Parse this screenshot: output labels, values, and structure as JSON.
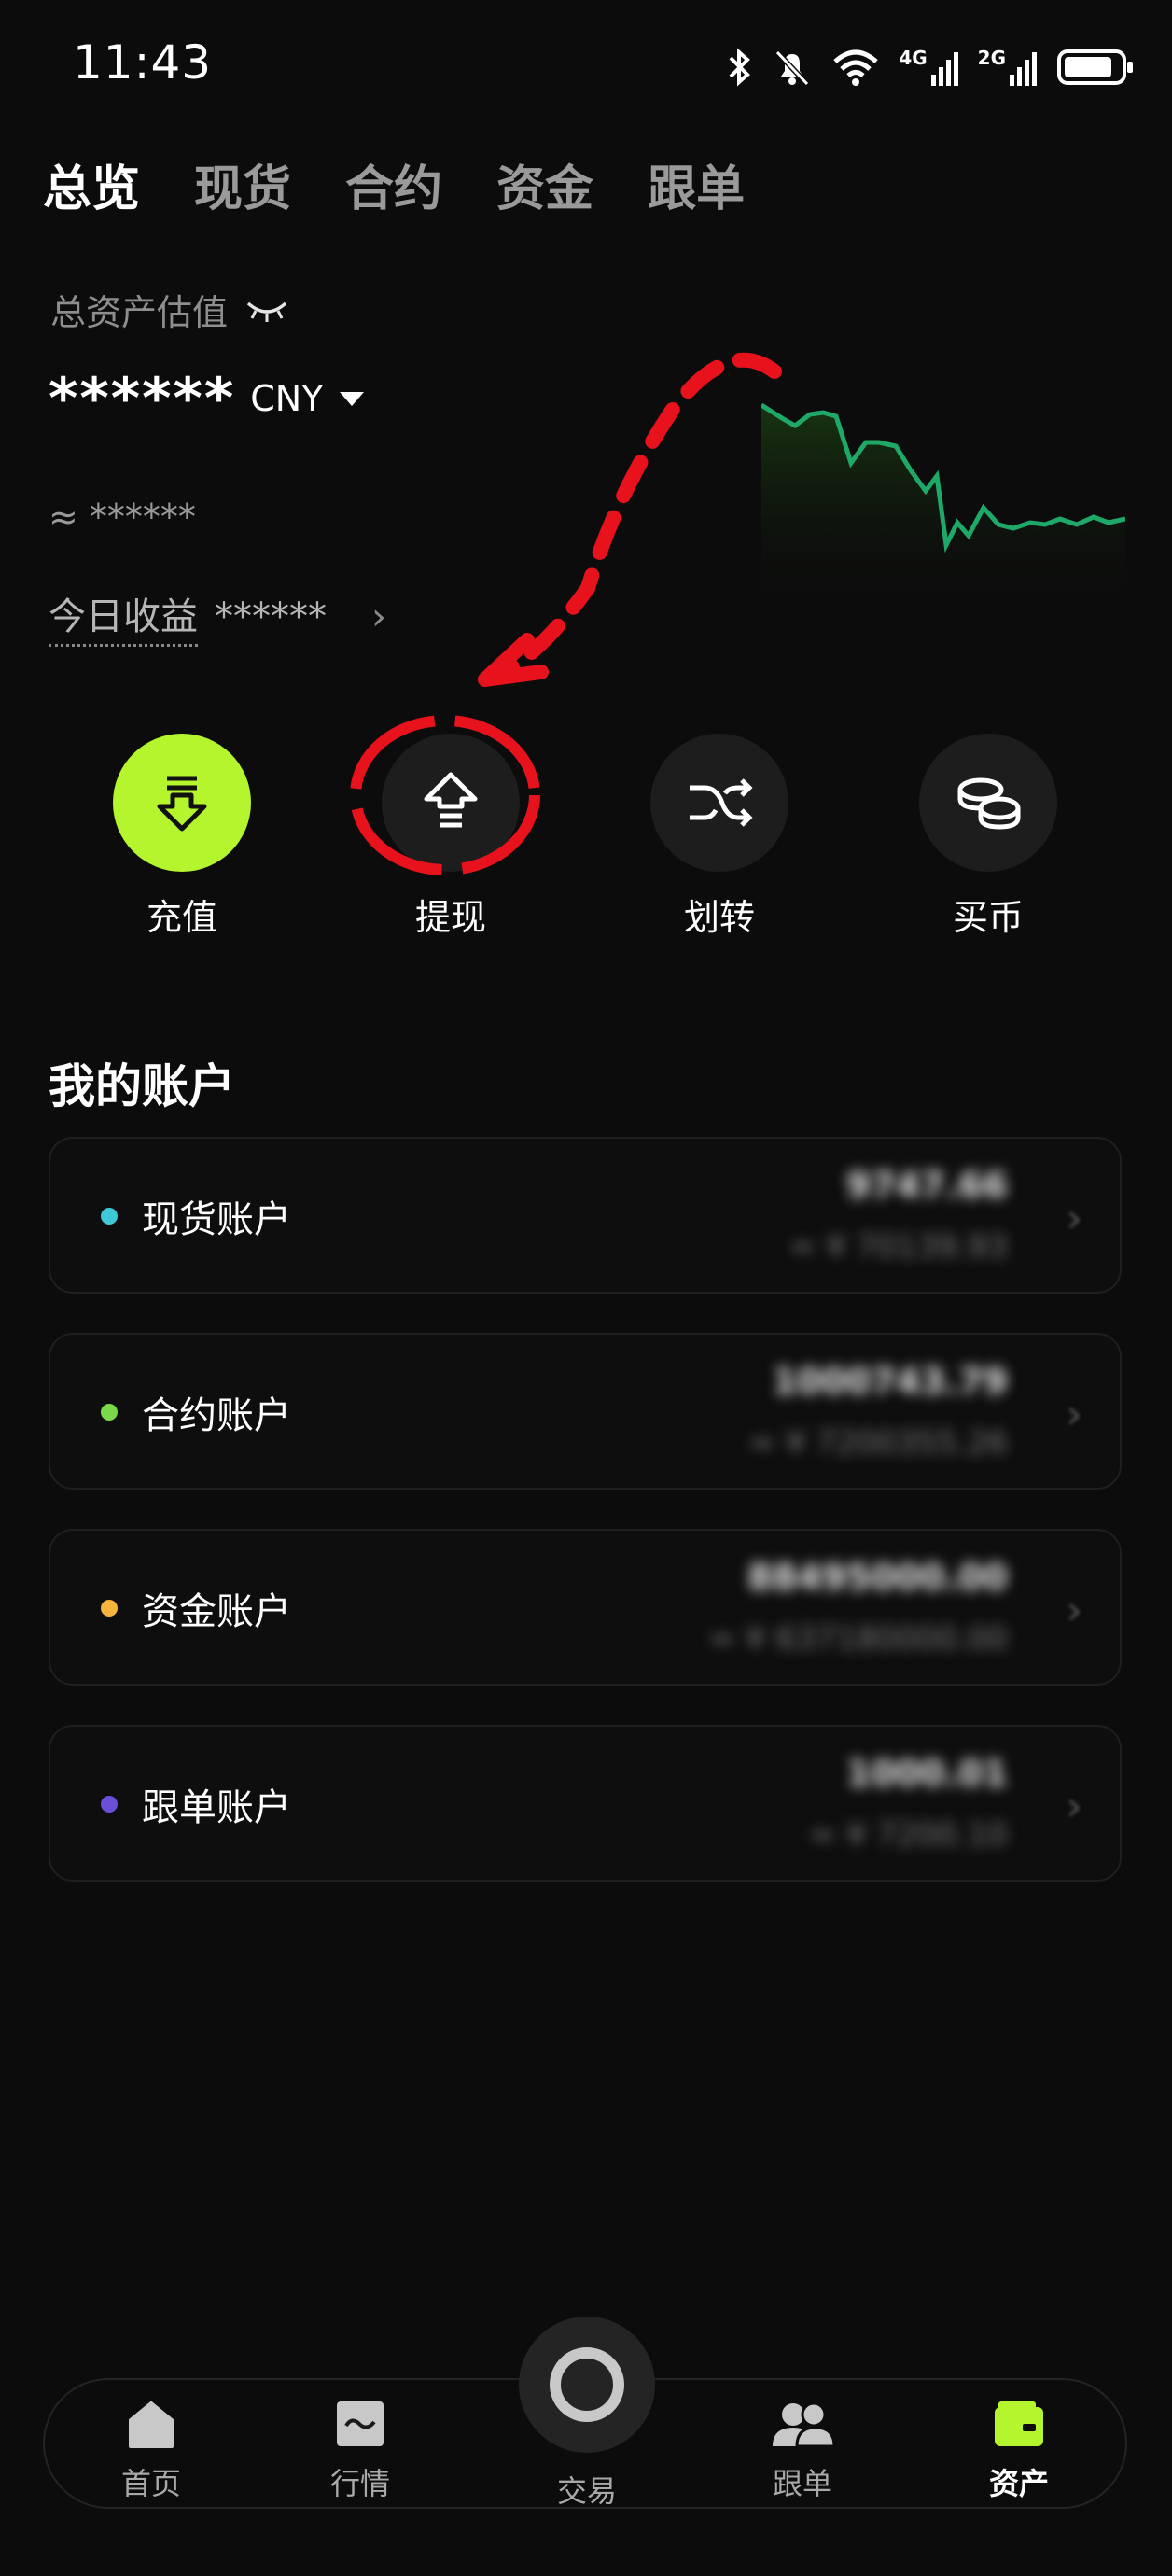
{
  "status_bar": {
    "time": "11:43",
    "signal_4g": "4G",
    "signal_2g": "2G"
  },
  "tabs": [
    {
      "label": "总览",
      "active": true
    },
    {
      "label": "现货",
      "active": false
    },
    {
      "label": "合约",
      "active": false
    },
    {
      "label": "资金",
      "active": false
    },
    {
      "label": "跟单",
      "active": false
    }
  ],
  "overview": {
    "total_label": "总资产估值",
    "total_value": "******",
    "currency": "CNY",
    "approx_value": "≈ ******",
    "pnl_label": "今日收益",
    "pnl_value": "******",
    "sparkline_color": "#1fa968"
  },
  "actions": [
    {
      "label": "充值",
      "icon": "deposit-icon"
    },
    {
      "label": "提现",
      "icon": "withdraw-icon"
    },
    {
      "label": "划转",
      "icon": "transfer-icon"
    },
    {
      "label": "买币",
      "icon": "buy-coin-icon"
    }
  ],
  "accounts": {
    "title": "我的账户",
    "items": [
      {
        "name": "现货账户",
        "dot_color": "#3ec9d6",
        "value": "9747.66",
        "approx": "≈ ¥ 70139.93"
      },
      {
        "name": "合约账户",
        "dot_color": "#7bd84a",
        "value": "1000743.79",
        "approx": "≈ ¥ 7200355.26"
      },
      {
        "name": "资金账户",
        "dot_color": "#f5b53d",
        "value": "88495000.00",
        "approx": "≈ ¥ 637180000.00"
      },
      {
        "name": "跟单账户",
        "dot_color": "#6b4fd8",
        "value": "1000.01",
        "approx": "≈ ¥ 7200.10"
      }
    ]
  },
  "bottom_nav": [
    {
      "label": "首页",
      "icon": "home-icon",
      "active": false
    },
    {
      "label": "行情",
      "icon": "market-icon",
      "active": false
    },
    {
      "label": "交易",
      "icon": "trade-icon",
      "active": false
    },
    {
      "label": "跟单",
      "icon": "copy-trade-icon",
      "active": false
    },
    {
      "label": "资产",
      "icon": "wallet-icon",
      "active": true
    }
  ],
  "colors": {
    "accent": "#b5f52d",
    "annotation": "#e8121c"
  }
}
